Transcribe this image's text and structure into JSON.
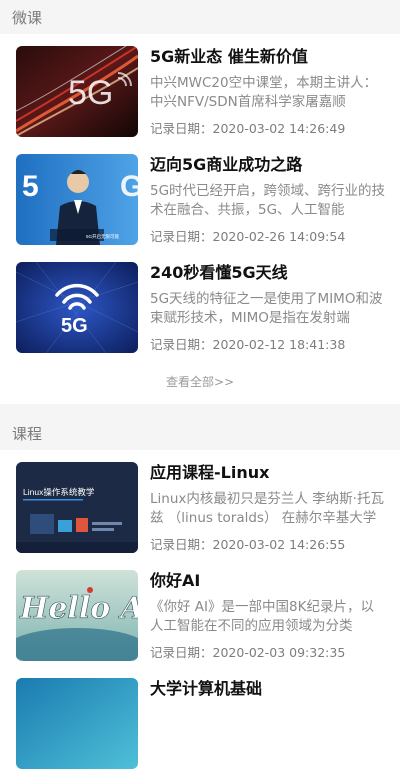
{
  "sections": {
    "micro": {
      "title": "微课",
      "view_all": "查看全部>>",
      "items": [
        {
          "title": "5G新业态 催生新价值",
          "desc": "中兴MWC20空中课堂，本期主讲人：中兴NFV/SDN首席科学家屠嘉顺",
          "date_label": "记录日期：",
          "date": "2020-03-02 14:26:49",
          "thumb_text": "5G"
        },
        {
          "title": "迈向5G商业成功之路",
          "desc": "5G时代已经开启，跨领域、跨行业的技术在融合、共振，5G、人工智能",
          "date_label": "记录日期：",
          "date": "2020-02-26 14:09:54",
          "thumb_text": "5",
          "thumb_caption": "5G开启无限可能"
        },
        {
          "title": "240秒看懂5G天线",
          "desc": "5G天线的特征之一是使用了MIMO和波束赋形技术，MIMO是指在发射端",
          "date_label": "记录日期：",
          "date": "2020-02-12 18:41:38",
          "thumb_text": "5G"
        }
      ]
    },
    "course": {
      "title": "课程",
      "items": [
        {
          "title": "应用课程-Linux",
          "desc": "Linux内核最初只是芬兰人 李纳斯·托瓦兹 （linus toralds） 在赫尔辛基大学",
          "date_label": "记录日期：",
          "date": "2020-03-02 14:26:55",
          "thumb_text": "Linux操作系统教学"
        },
        {
          "title": "你好AI",
          "desc": "《你好 AI》是一部中国8K纪录片，以人工智能在不同的应用领域为分类",
          "date_label": "记录日期：",
          "date": "2020-02-03 09:32:35",
          "thumb_text": "Hello AI"
        },
        {
          "title": "大学计算机基础",
          "desc": "",
          "date_label": "",
          "date": "",
          "thumb_text": ""
        }
      ]
    }
  },
  "colors": {
    "accent_dark": "#1b2a4a",
    "blue": "#2a6fc9"
  }
}
